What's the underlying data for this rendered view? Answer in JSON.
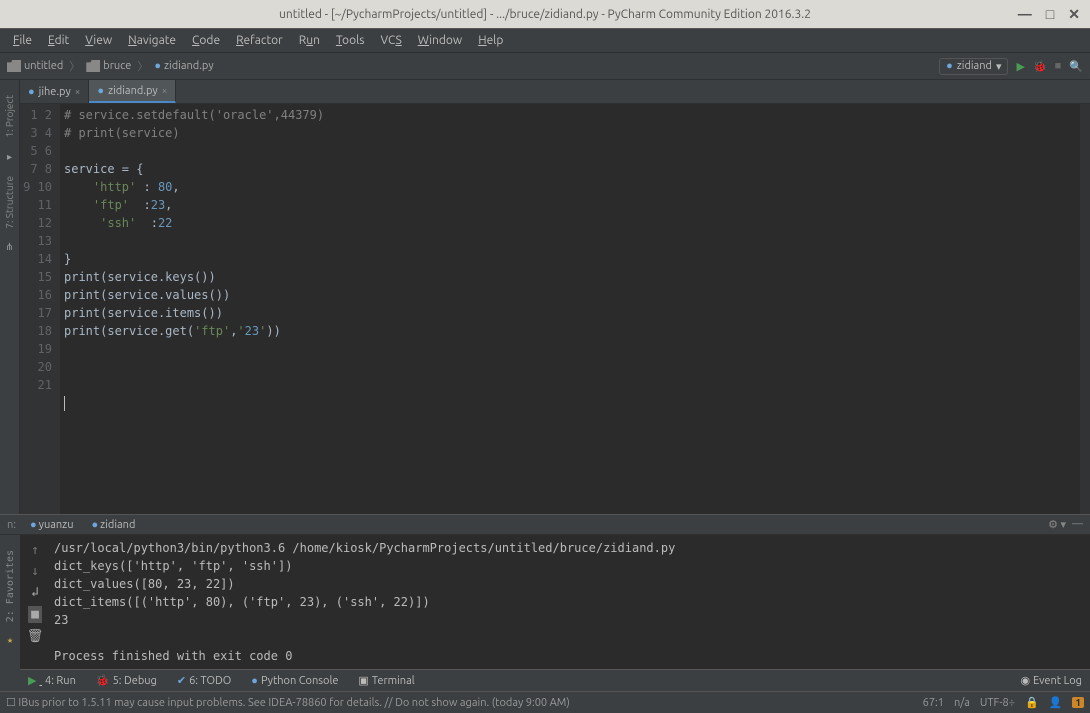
{
  "titlebar": {
    "text": "untitled - [~/PycharmProjects/untitled] - .../bruce/zidiand.py - PyCharm Community Edition 2016.3.2"
  },
  "menu": {
    "file": "File",
    "edit": "Edit",
    "view": "View",
    "navigate": "Navigate",
    "code": "Code",
    "refactor": "Refactor",
    "run": "Run",
    "tools": "Tools",
    "vcs": "VCS",
    "window": "Window",
    "help": "Help"
  },
  "breadcrumbs": {
    "root": "untitled",
    "folder": "bruce",
    "file": "zidiand.py"
  },
  "run_config": {
    "name": "zidiand"
  },
  "side_tools": {
    "project": "1: Project",
    "structure": "7: Structure",
    "favorites": "2: Favorites"
  },
  "tabs": [
    {
      "name": "jihe.py",
      "active": false
    },
    {
      "name": "zidiand.py",
      "active": true
    }
  ],
  "editor": {
    "start_line": 1,
    "lines": [
      {
        "raw": "# service.setdefault('oracle',44379)",
        "type": "comment"
      },
      {
        "raw": "# print(service)",
        "type": "comment"
      },
      {
        "raw": ""
      },
      {
        "raw": "service = {"
      },
      {
        "raw": "    'http' : 80,"
      },
      {
        "raw": "    'ftp'  :23,"
      },
      {
        "raw": "     'ssh'  :22"
      },
      {
        "raw": ""
      },
      {
        "raw": "}"
      },
      {
        "raw": "print(service.keys())"
      },
      {
        "raw": "print(service.values())"
      },
      {
        "raw": "print(service.items())"
      },
      {
        "raw": "print(service.get('ftp','23'))"
      },
      {
        "raw": ""
      },
      {
        "raw": ""
      },
      {
        "raw": ""
      },
      {
        "raw": ""
      },
      {
        "raw": ""
      },
      {
        "raw": ""
      },
      {
        "raw": ""
      },
      {
        "raw": ""
      }
    ]
  },
  "run_panel": {
    "tabs": {
      "t1": "yuanzu",
      "t2": "zidiand"
    },
    "output": [
      "/usr/local/python3/bin/python3.6 /home/kiosk/PycharmProjects/untitled/bruce/zidiand.py",
      "dict_keys(['http', 'ftp', 'ssh'])",
      "dict_values([80, 23, 22])",
      "dict_items([('http', 80), ('ftp', 23), ('ssh', 22)])",
      "23",
      "",
      "Process finished with exit code 0"
    ]
  },
  "tools": {
    "run": "4: Run",
    "debug": "5: Debug",
    "todo": "6: TODO",
    "pyconsole": "Python Console",
    "terminal": "Terminal",
    "eventlog": "Event Log"
  },
  "status": {
    "msg": "IBus prior to 1.5.11 may cause input problems. See IDEA-78860 for details. // Do not show again. (today 9:00 AM)",
    "pos": "67:1",
    "indent": "n/a",
    "enc": "UTF-8",
    "warn": "1"
  }
}
